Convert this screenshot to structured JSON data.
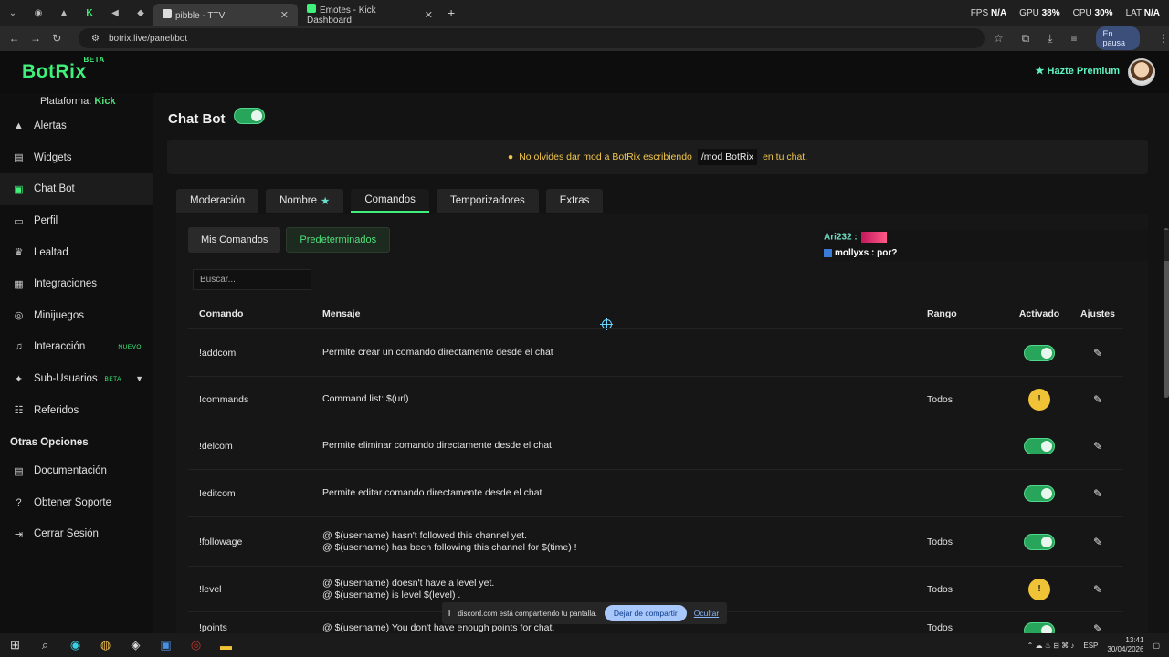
{
  "browser": {
    "tabs": [
      {
        "title": "pibble - TTV",
        "active": true
      },
      {
        "title": "Emotes - Kick Dashboard",
        "active": false
      }
    ],
    "url": "botrix.live/panel/bot",
    "paused_label": "En pausa",
    "perf": {
      "fps_label": "FPS",
      "fps": "N/A",
      "gpu_label": "GPU",
      "gpu": "38%",
      "cpu_label": "CPU",
      "cpu": "30%",
      "lat_label": "LAT",
      "lat": "N/A"
    }
  },
  "header": {
    "logo": "BotRix",
    "logo_badge": "BETA",
    "premium_label": "Hazte Premium"
  },
  "sidebar": {
    "platform_label": "Plataforma:",
    "platform_value": "Kick",
    "items": [
      {
        "label": "Alertas",
        "icon": "alert-icon"
      },
      {
        "label": "Widgets",
        "icon": "widgets-icon"
      },
      {
        "label": "Chat Bot",
        "icon": "robot-icon",
        "active": true
      },
      {
        "label": "Perfil",
        "icon": "profile-icon"
      },
      {
        "label": "Lealtad",
        "icon": "trophy-icon"
      },
      {
        "label": "Integraciones",
        "icon": "plugin-icon"
      },
      {
        "label": "Minijuegos",
        "icon": "gamepad-icon"
      },
      {
        "label": "Interacción",
        "icon": "music-icon",
        "badge": "NUEVO"
      },
      {
        "label": "Sub-Usuarios",
        "icon": "users-icon",
        "badge": "BETA"
      },
      {
        "label": "Referidos",
        "icon": "referral-icon"
      }
    ],
    "other_heading": "Otras Opciones",
    "other_items": [
      {
        "label": "Documentación",
        "icon": "doc-icon"
      },
      {
        "label": "Obtener Soporte",
        "icon": "help-icon"
      },
      {
        "label": "Cerrar Sesión",
        "icon": "logout-icon"
      }
    ]
  },
  "main": {
    "title": "Chat Bot",
    "alert_text_1": "No olvides dar mod a BotRix escribiendo",
    "alert_command": "/mod BotRix",
    "alert_text_2": "en tu chat.",
    "tabs": [
      {
        "label": "Moderación"
      },
      {
        "label": "Nombre"
      },
      {
        "label": "Comandos",
        "active": true
      },
      {
        "label": "Temporizadores"
      },
      {
        "label": "Extras"
      }
    ],
    "subtabs": [
      {
        "label": "Mis Comandos"
      },
      {
        "label": "Predeterminados",
        "selected": true
      }
    ],
    "search_placeholder": "Buscar...",
    "columns": [
      "Comando",
      "Mensaje",
      "Rango",
      "Activado",
      "Ajustes"
    ],
    "rows": [
      {
        "command": "!addcom",
        "lines": [
          "Permite crear un comando directamente desde el chat"
        ],
        "rank": "",
        "status": "on"
      },
      {
        "command": "!commands",
        "lines": [
          "Command list: $(url)"
        ],
        "rank": "Todos",
        "status": "warn"
      },
      {
        "command": "!delcom",
        "lines": [
          "Permite eliminar comando directamente desde el chat"
        ],
        "rank": "",
        "status": "on"
      },
      {
        "command": "!editcom",
        "lines": [
          "Permite editar comando directamente desde el chat"
        ],
        "rank": "",
        "status": "on"
      },
      {
        "command": "!followage",
        "lines": [
          "@ $(username) hasn't followed this channel yet.",
          "@ $(username) has been following this channel for $(time) !"
        ],
        "rank": "Todos",
        "status": "on"
      },
      {
        "command": "!level",
        "lines": [
          "@ $(username) doesn't have a level yet.",
          "@ $(username) is level $(level) ."
        ],
        "rank": "Todos",
        "status": "warn"
      },
      {
        "command": "!points",
        "lines": [
          "@ $(username) You don't have enough points for chat."
        ],
        "rank": "Todos",
        "status": "on"
      }
    ]
  },
  "chat_overlay": {
    "line1_user": "Ari232 :",
    "line2": "mollyxs : por?"
  },
  "share_bar": {
    "text": "discord.com está compartiendo tu pantalla.",
    "stop_label": "Dejar de compartir",
    "hide_label": "Ocultar"
  },
  "taskbar": {
    "lang": "ESP",
    "time": "13:41",
    "date": "30/04/2026"
  },
  "colors": {
    "accent": "#3ff07a",
    "warning": "#f0c235",
    "premium": "#5ff2c2"
  }
}
